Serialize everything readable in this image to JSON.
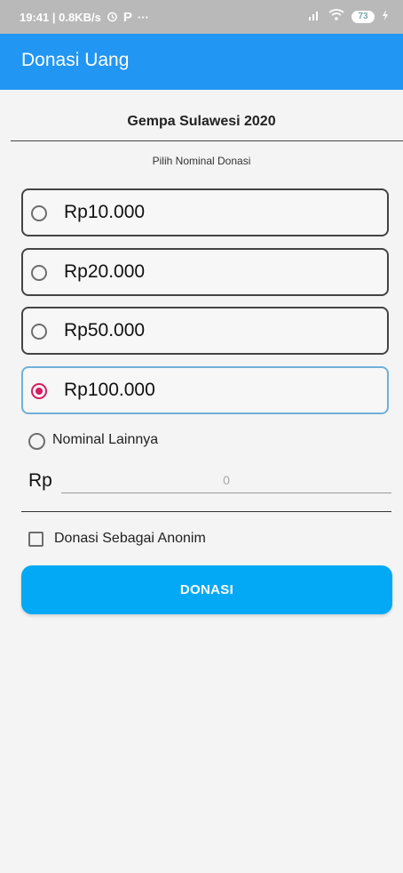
{
  "status_bar": {
    "time_speed": "19:41 | 0.8KB/s",
    "alarm_icon": "alarm-icon",
    "p_icon": "P",
    "more": "···",
    "signal_icon": "signal-icon",
    "wifi_icon": "wifi-icon",
    "battery": "73"
  },
  "app_bar": {
    "title": "Donasi Uang",
    "color": "#2196f3"
  },
  "campaign": {
    "title": "Gempa Sulawesi 2020",
    "subtitle": "Pilih Nominal Donasi"
  },
  "options": [
    {
      "label": "Rp10.000",
      "selected": false
    },
    {
      "label": "Rp20.000",
      "selected": false
    },
    {
      "label": "Rp50.000",
      "selected": false
    },
    {
      "label": "Rp100.000",
      "selected": true
    }
  ],
  "other_amount": {
    "label": "Nominal Lainnya",
    "currency": "Rp",
    "placeholder": "0",
    "selected": false
  },
  "anonymous": {
    "label": "Donasi Sebagai Anonim",
    "checked": false
  },
  "submit": {
    "label": "DONASI",
    "color": "#03a9f4"
  },
  "accent_color": "#d81b60"
}
